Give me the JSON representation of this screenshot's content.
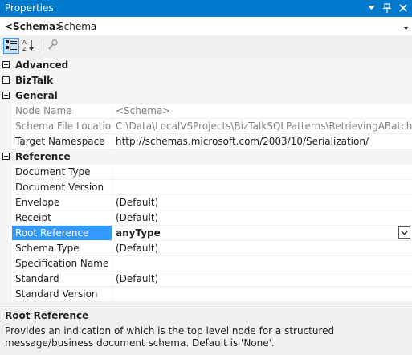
{
  "window": {
    "title": "Properties"
  },
  "title_icons": [
    "dropdown-icon",
    "pin-icon",
    "close-icon"
  ],
  "object_selector": {
    "name": "<Schema>",
    "type": "Schema"
  },
  "toolbar": {
    "buttons": [
      "categorized-icon",
      "alphabetical-icon",
      "property-pages-icon"
    ]
  },
  "grid": {
    "advanced": {
      "label": "Advanced"
    },
    "biztalk": {
      "label": "BizTalk"
    },
    "general": {
      "label": "General",
      "node_name": {
        "name": "Node Name",
        "value": "<Schema>"
      },
      "schema_file_location": {
        "name": "Schema File Location",
        "value": "C:\\Data\\LocalVSProjects\\BizTalkSQLPatterns\\RetrievingABatch\\getSale"
      },
      "target_namespace": {
        "name": "Target Namespace",
        "value": "http://schemas.microsoft.com/2003/10/Serialization/"
      }
    },
    "reference": {
      "label": "Reference",
      "document_type": {
        "name": "Document Type",
        "value": ""
      },
      "document_version": {
        "name": "Document Version",
        "value": ""
      },
      "envelope": {
        "name": "Envelope",
        "value": "(Default)"
      },
      "receipt": {
        "name": "Receipt",
        "value": "(Default)"
      },
      "root_reference": {
        "name": "Root Reference",
        "value": "anyType"
      },
      "schema_type": {
        "name": "Schema Type",
        "value": "(Default)"
      },
      "specification_name": {
        "name": "Specification Name",
        "value": ""
      },
      "standard": {
        "name": "Standard",
        "value": "(Default)"
      },
      "standard_version": {
        "name": "Standard Version",
        "value": ""
      }
    }
  },
  "description": {
    "title": "Root Reference",
    "text": "Provides an indication of which is the top level node for a structured message/business document schema. Default is 'None'."
  },
  "colors": {
    "accent": "#007acc",
    "selection": "#3399ff"
  }
}
